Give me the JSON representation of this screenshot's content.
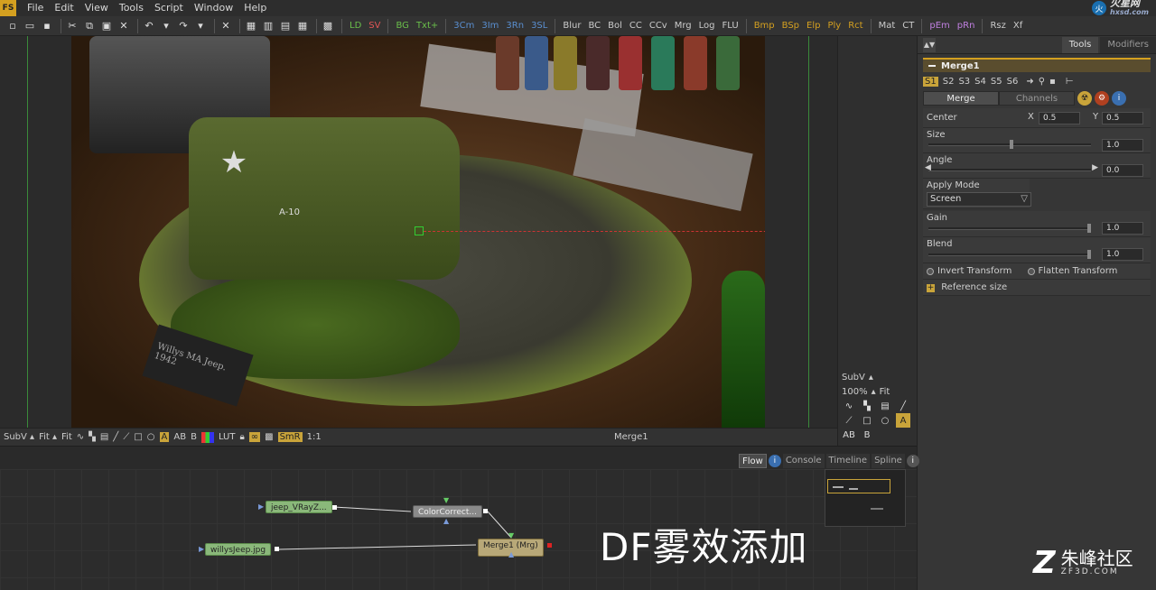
{
  "app": {
    "logo": "FS"
  },
  "menu": [
    "File",
    "Edit",
    "View",
    "Tools",
    "Script",
    "Window",
    "Help"
  ],
  "watermark_top": {
    "text": "火星网",
    "sub": "hxsd.com"
  },
  "toolbar": {
    "buttons": [
      "LD",
      "SV",
      "BG",
      "Txt+",
      "3Cm",
      "3Im",
      "3Rn",
      "3SL",
      "Blur",
      "BC",
      "Bol",
      "CC",
      "CCv",
      "Mrg",
      "Log",
      "FLU",
      "Bmp",
      "BSp",
      "Elp",
      "Ply",
      "Rct",
      "Mat",
      "CT",
      "pEm",
      "pRn",
      "Rsz",
      "Xf"
    ],
    "button_colors": [
      "#6abf4b",
      "#e05555",
      "#6abf4b",
      "#6abf4b",
      "#5a8fd0",
      "#5a8fd0",
      "#5a8fd0",
      "#5a8fd0",
      "#cccccc",
      "#cccccc",
      "#cccccc",
      "#cccccc",
      "#cccccc",
      "#cccccc",
      "#cccccc",
      "#cccccc",
      "#d4a020",
      "#d4a020",
      "#d4a020",
      "#d4a020",
      "#d4a020",
      "#cccccc",
      "#cccccc",
      "#c080e0",
      "#c080e0",
      "#cccccc",
      "#cccccc"
    ]
  },
  "scene": {
    "plate_text": "Willys MA Jeep. 1942",
    "jeep_number": "A-10"
  },
  "viewer_bar": {
    "subv": "SubV",
    "fit1": "Fit",
    "fit2": "Fit",
    "ab": "AB",
    "b": "B",
    "lut": "LUT",
    "smr": "SmR",
    "ratio": "1:1",
    "title": "Merge1"
  },
  "viewer_side": {
    "subv": "SubV",
    "zoom": "100%",
    "fit": "Fit",
    "ab": "AB",
    "b": "B",
    "a": "A"
  },
  "inspector": {
    "tabs": [
      "Tools",
      "Modifiers"
    ],
    "node_name": "Merge1",
    "slots": [
      "S1",
      "S2",
      "S3",
      "S4",
      "S5",
      "S6"
    ],
    "sub_tabs": [
      "Merge",
      "Channels"
    ],
    "center": {
      "label": "Center",
      "x_label": "X",
      "x": "0.5",
      "y_label": "Y",
      "y": "0.5"
    },
    "size": {
      "label": "Size",
      "value": "1.0"
    },
    "angle": {
      "label": "Angle",
      "value": "0.0"
    },
    "apply_mode": {
      "label": "Apply Mode",
      "value": "Screen"
    },
    "gain": {
      "label": "Gain",
      "value": "1.0"
    },
    "blend": {
      "label": "Blend",
      "value": "1.0"
    },
    "invert_transform": "Invert Transform",
    "flatten_transform": "Flatten Transform",
    "reference_size": "Reference size"
  },
  "flow_tabs": [
    "Flow",
    "Console",
    "Timeline",
    "Spline"
  ],
  "flow_nodes": {
    "jeep": "jeep_VRayZ...",
    "color": "ColorCorrect...",
    "willys": "willysJeep.jpg",
    "merge": "Merge1 (Mrg)"
  },
  "caption": "DF雾效添加",
  "brand": {
    "cn": "朱峰社区",
    "en": "ZF3D.COM"
  }
}
